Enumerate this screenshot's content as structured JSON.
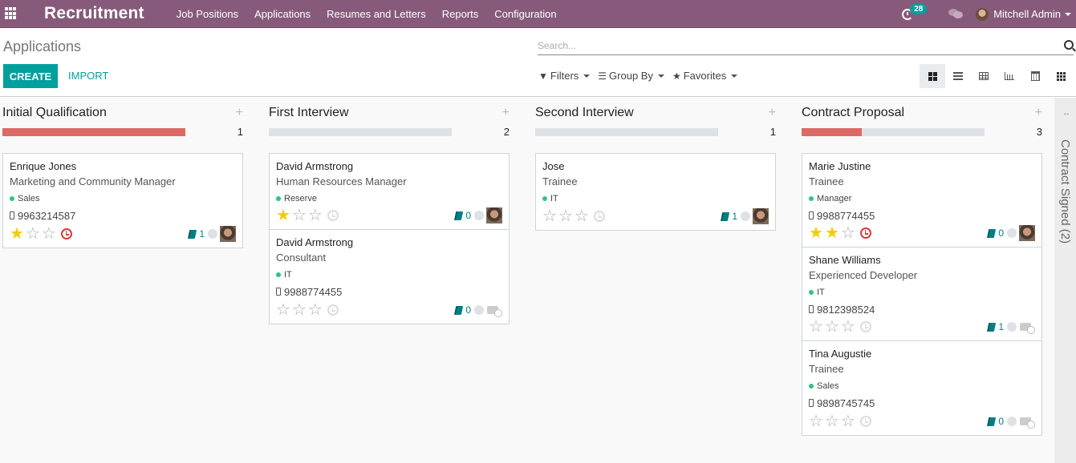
{
  "navbar": {
    "app_title": "Recruitment",
    "menu": [
      "Job Positions",
      "Applications",
      "Resumes and Letters",
      "Reports",
      "Configuration"
    ],
    "activity_count": "28",
    "user_name": "Mitchell Admin",
    "color": "#875A7B"
  },
  "control_panel": {
    "breadcrumb": "Applications",
    "create_label": "CREATE",
    "import_label": "IMPORT",
    "search_placeholder": "Search...",
    "filters_label": "Filters",
    "group_by_label": "Group By",
    "favorites_label": "Favorites",
    "views": [
      "kanban",
      "list",
      "pivot",
      "graph",
      "calendar",
      "activity"
    ],
    "active_view": "kanban",
    "accent": "#00A09D"
  },
  "columns": [
    {
      "title": "Initial Qualification",
      "count": "1",
      "progress_red_fraction": 1.0,
      "cards": [
        {
          "name": "Enrique Jones",
          "job": "Marketing and Community Manager",
          "tag": "Sales",
          "phone": "9963214587",
          "stars": 1,
          "activity_overdue": true,
          "attachments": "1",
          "avatar": "photo"
        }
      ]
    },
    {
      "title": "First Interview",
      "count": "2",
      "progress_red_fraction": 0.0,
      "cards": [
        {
          "name": "David Armstrong",
          "job": "Human Resources Manager",
          "tag": "Reserve",
          "phone": "",
          "stars": 1,
          "activity_overdue": false,
          "attachments": "0",
          "avatar": "photo"
        },
        {
          "name": "David Armstrong",
          "job": "Consultant",
          "tag": "IT",
          "phone": "9988774455",
          "stars": 0,
          "activity_overdue": false,
          "attachments": "0",
          "avatar": "placeholder"
        }
      ]
    },
    {
      "title": "Second Interview",
      "count": "1",
      "progress_red_fraction": 0.0,
      "cards": [
        {
          "name": "Jose",
          "job": "Trainee",
          "tag": "IT",
          "phone": "",
          "stars": 0,
          "activity_overdue": false,
          "attachments": "1",
          "avatar": "photo"
        }
      ]
    },
    {
      "title": "Contract Proposal",
      "count": "3",
      "progress_red_fraction": 0.33,
      "cards": [
        {
          "name": "Marie Justine",
          "job": "Trainee",
          "tag": "Manager",
          "phone": "9988774455",
          "stars": 2,
          "activity_overdue": true,
          "attachments": "0",
          "avatar": "photo"
        },
        {
          "name": "Shane Williams",
          "job": "Experienced Developer",
          "tag": "IT",
          "phone": "9812398524",
          "stars": 0,
          "activity_overdue": false,
          "attachments": "1",
          "avatar": "placeholder"
        },
        {
          "name": "Tina Augustie",
          "job": "Trainee",
          "tag": "Sales",
          "phone": "9898745745",
          "stars": 0,
          "activity_overdue": false,
          "attachments": "0",
          "avatar": "placeholder"
        }
      ]
    }
  ],
  "folded_column": {
    "label": "Contract Signed (2)"
  }
}
